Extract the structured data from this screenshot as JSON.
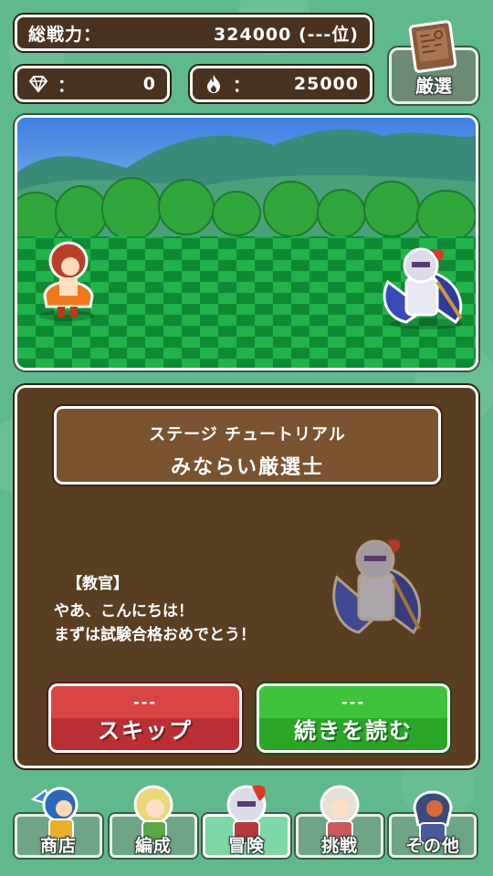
{
  "header": {
    "total_power_label": "総戦力：",
    "total_power_value": "324000 (---位)",
    "gems_colon": "：",
    "gems_value": "0",
    "flames_colon": "：",
    "flames_value": "25000",
    "gensen_label": "厳選"
  },
  "dialog": {
    "stage_label": "ステージ チュートリアル",
    "stage_name": "みならい厳選士",
    "speaker": "【教官】",
    "line1": "やあ、こんにちは！",
    "line2": "まずは試験合格おめでとう！"
  },
  "buttons": {
    "skip_dashes": "---",
    "skip_label": "スキップ",
    "continue_dashes": "---",
    "continue_label": "続きを読む"
  },
  "nav": {
    "tabs": [
      {
        "label": "商店",
        "icon": "shop-character-icon",
        "active": false
      },
      {
        "label": "編成",
        "icon": "party-character-icon",
        "active": false
      },
      {
        "label": "冒険",
        "icon": "adventure-character-icon",
        "active": true
      },
      {
        "label": "挑戦",
        "icon": "challenge-character-icon",
        "active": false
      },
      {
        "label": "その他",
        "icon": "other-character-icon",
        "active": false
      }
    ]
  },
  "icons": {
    "gems": "diamond-icon",
    "flames": "flame-icon",
    "gensen": "book-icon"
  },
  "colors": {
    "background": "#5fb98c",
    "panel": "#5a3e22",
    "skip": "#d94545",
    "continue": "#3ec43b"
  }
}
